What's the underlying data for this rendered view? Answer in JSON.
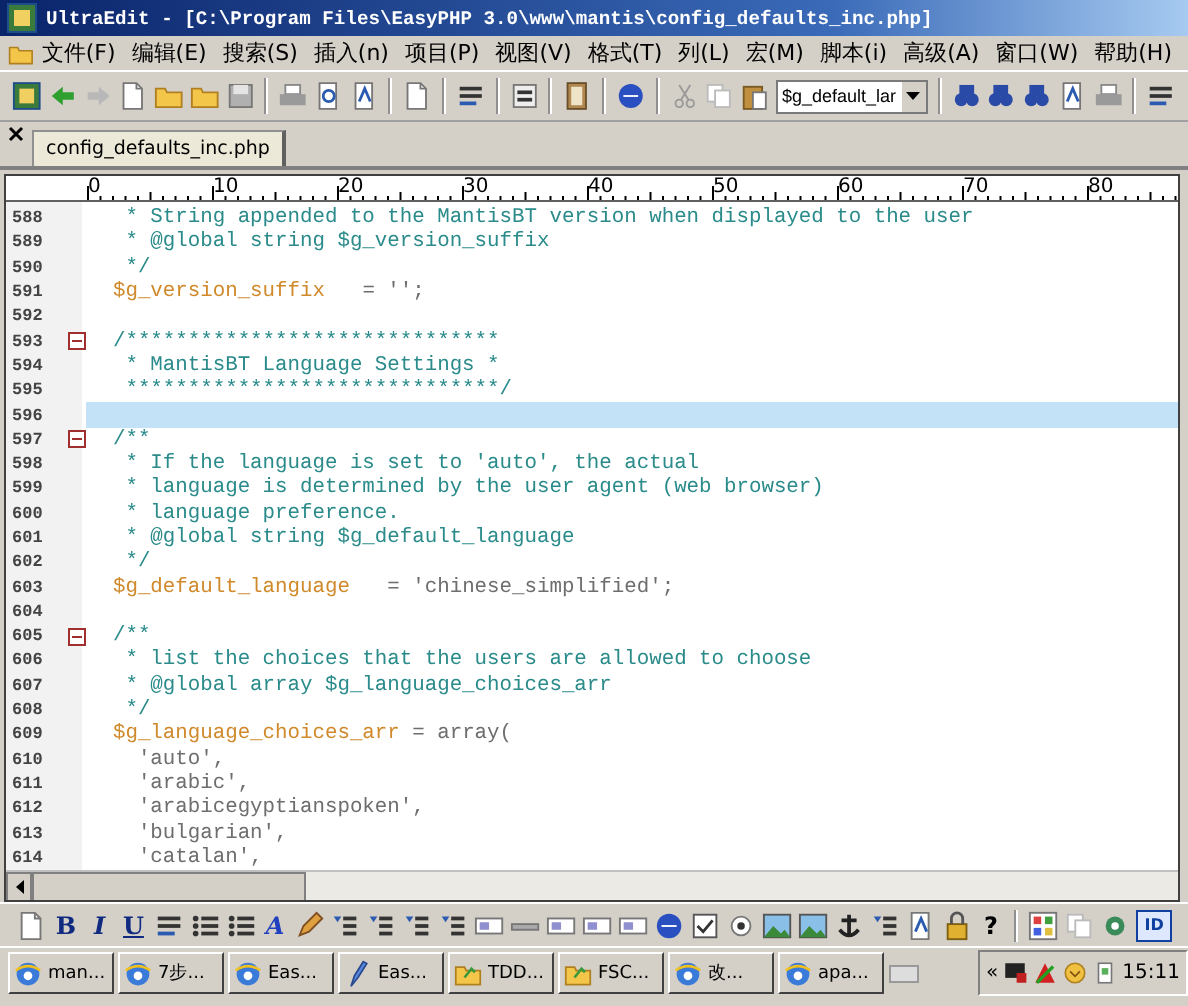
{
  "window": {
    "title": "UltraEdit - [C:\\Program Files\\EasyPHP 3.0\\www\\mantis\\config_defaults_inc.php]"
  },
  "menu": [
    "文件(F)",
    "编辑(E)",
    "搜索(S)",
    "插入(n)",
    "项目(P)",
    "视图(V)",
    "格式(T)",
    "列(L)",
    "宏(M)",
    "脚本(i)",
    "高级(A)",
    "窗口(W)",
    "帮助(H)"
  ],
  "toolbar": {
    "combo_value": "$g_default_lar"
  },
  "tabs": [
    {
      "label": "config_defaults_inc.php",
      "selected": true
    }
  ],
  "ruler_labels": [
    "0",
    "10",
    "20",
    "30",
    "40",
    "50",
    "60",
    "70",
    "80"
  ],
  "lines": [
    {
      "number": "588",
      "current": false,
      "tokens": [
        {
          "kind": "comment",
          "text": "   * String appended to the MantisBT version when displayed to the user"
        }
      ]
    },
    {
      "number": "589",
      "current": false,
      "tokens": [
        {
          "kind": "comment",
          "text": "   * @global string $g_version_suffix"
        }
      ]
    },
    {
      "number": "590",
      "current": false,
      "tokens": [
        {
          "kind": "comment",
          "text": "   */"
        }
      ]
    },
    {
      "number": "591",
      "current": false,
      "tokens": [
        {
          "kind": "variable",
          "text": "  $g_version_suffix"
        },
        {
          "kind": "code",
          "text": "   = '';"
        }
      ]
    },
    {
      "number": "592",
      "current": false,
      "collapsible": false
    },
    {
      "number": "593",
      "current": false,
      "collapsible": true,
      "tokens": [
        {
          "kind": "comment",
          "text": "  /******************************"
        }
      ]
    },
    {
      "number": "594",
      "current": false,
      "tokens": [
        {
          "kind": "comment",
          "text": "   * MantisBT Language Settings *"
        }
      ]
    },
    {
      "number": "595",
      "current": false,
      "tokens": [
        {
          "kind": "comment",
          "text": "   ******************************/"
        }
      ]
    },
    {
      "number": "596",
      "current": true,
      "collapsible": false
    },
    {
      "number": "597",
      "current": false,
      "collapsible": true,
      "tokens": [
        {
          "kind": "comment",
          "text": "  /**"
        }
      ]
    },
    {
      "number": "598",
      "current": false,
      "tokens": [
        {
          "kind": "comment",
          "text": "   * If the language is set to 'auto', the actual"
        }
      ]
    },
    {
      "number": "599",
      "current": false,
      "tokens": [
        {
          "kind": "comment",
          "text": "   * language is determined by the user agent (web browser)"
        }
      ]
    },
    {
      "number": "600",
      "current": false,
      "tokens": [
        {
          "kind": "comment",
          "text": "   * language preference."
        }
      ]
    },
    {
      "number": "601",
      "current": false,
      "tokens": [
        {
          "kind": "comment",
          "text": "   * @global string $g_default_language"
        }
      ]
    },
    {
      "number": "602",
      "current": false,
      "tokens": [
        {
          "kind": "comment",
          "text": "   */"
        }
      ]
    },
    {
      "number": "603",
      "current": false,
      "tokens": [
        {
          "kind": "variable",
          "text": "  $g_default_language"
        },
        {
          "kind": "code",
          "text": "   = 'chinese_simplified';"
        }
      ]
    },
    {
      "number": "604",
      "current": false,
      "collapsible": false
    },
    {
      "number": "605",
      "current": false,
      "collapsible": true,
      "tokens": [
        {
          "kind": "comment",
          "text": "  /**"
        }
      ]
    },
    {
      "number": "606",
      "current": false,
      "tokens": [
        {
          "kind": "comment",
          "text": "   * list the choices that the users are allowed to choose"
        }
      ]
    },
    {
      "number": "607",
      "current": false,
      "tokens": [
        {
          "kind": "comment",
          "text": "   * @global array $g_language_choices_arr"
        }
      ]
    },
    {
      "number": "608",
      "current": false,
      "tokens": [
        {
          "kind": "comment",
          "text": "   */"
        }
      ]
    },
    {
      "number": "609",
      "current": false,
      "tokens": [
        {
          "kind": "variable",
          "text": "  $g_language_choices_arr"
        },
        {
          "kind": "code",
          "text": " = array("
        }
      ]
    },
    {
      "number": "610",
      "current": false,
      "tokens": [
        {
          "kind": "code",
          "text": "    'auto',"
        }
      ]
    },
    {
      "number": "611",
      "current": false,
      "tokens": [
        {
          "kind": "code",
          "text": "    'arabic',"
        }
      ]
    },
    {
      "number": "612",
      "current": false,
      "tokens": [
        {
          "kind": "code",
          "text": "    'arabicegyptianspoken',"
        }
      ]
    },
    {
      "number": "613",
      "current": false,
      "tokens": [
        {
          "kind": "code",
          "text": "    'bulgarian',"
        }
      ]
    },
    {
      "number": "614",
      "current": false,
      "tokens": [
        {
          "kind": "code",
          "text": "    'catalan',"
        }
      ]
    }
  ],
  "format_toolbar": {
    "glyphs": [
      "B",
      "I",
      "U",
      "A",
      "?",
      "ID"
    ]
  },
  "taskbar": {
    "buttons": [
      {
        "label": "man...",
        "kind": "browser"
      },
      {
        "label": "7步...",
        "kind": "browser"
      },
      {
        "label": "Eas...",
        "kind": "browser"
      },
      {
        "label": "Eas...",
        "kind": "editor"
      },
      {
        "label": "TDD...",
        "kind": "folder"
      },
      {
        "label": "FSC...",
        "kind": "folder"
      },
      {
        "label": "改...",
        "kind": "browser"
      },
      {
        "label": "apa...",
        "kind": "browser"
      }
    ],
    "tray_expand": "«",
    "clock": "15:11"
  }
}
